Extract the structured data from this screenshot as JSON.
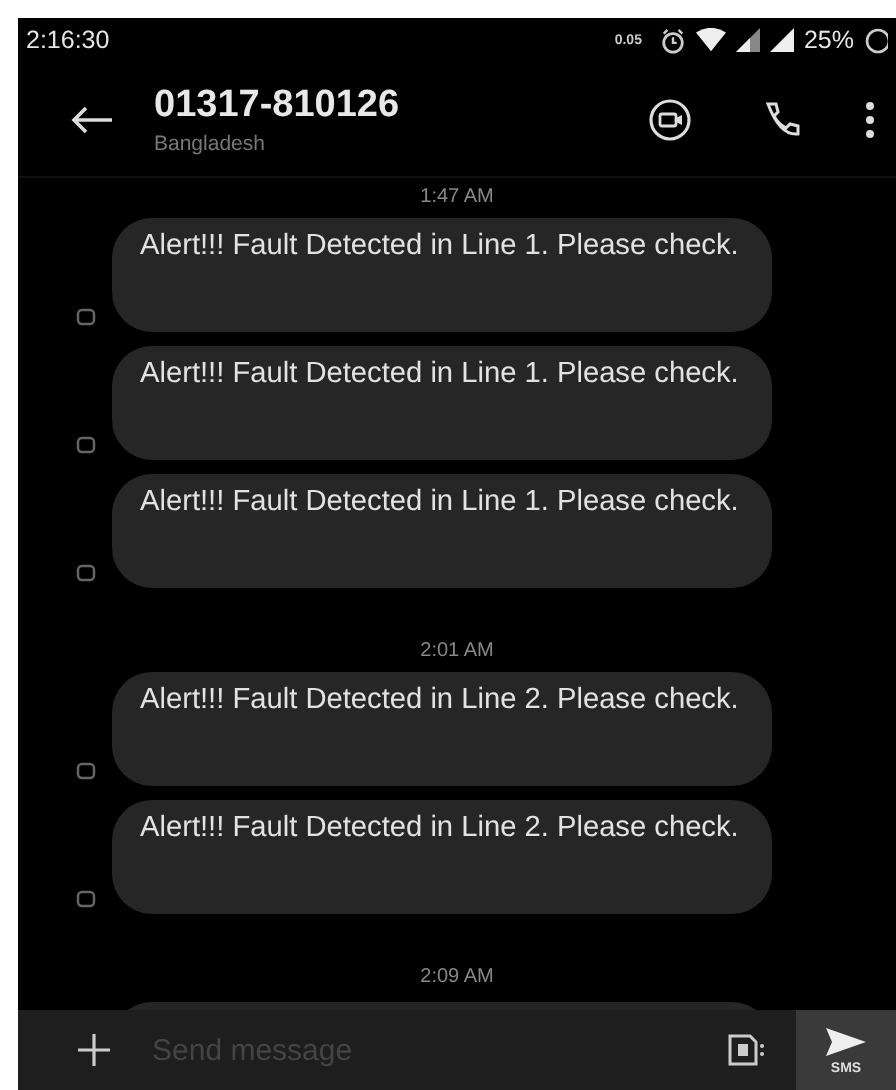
{
  "status_bar": {
    "time": "2:16:30",
    "net_speed": "0.05",
    "battery": "25%"
  },
  "header": {
    "title": "01317-810126",
    "subtitle": "Bangladesh"
  },
  "groups": [
    {
      "time": "1:47 AM",
      "messages": [
        {
          "text": "Alert!!! Fault Detected in Line 1. Please check."
        },
        {
          "text": "Alert!!! Fault Detected in Line 1. Please check."
        },
        {
          "text": "Alert!!! Fault Detected in Line 1. Please check."
        }
      ]
    },
    {
      "time": "2:01 AM",
      "messages": [
        {
          "text": "Alert!!! Fault Detected in Line 2. Please check."
        },
        {
          "text": "Alert!!! Fault Detected in Line 2. Please check."
        }
      ]
    },
    {
      "time": "2:09 AM"
    }
  ],
  "composer": {
    "placeholder": "Send message",
    "send_label": "SMS"
  }
}
